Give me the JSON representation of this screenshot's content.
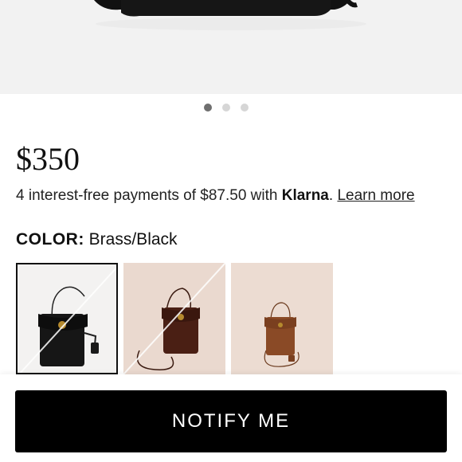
{
  "product": {
    "price": "$350",
    "installments_text": "4 interest-free payments of $87.50 with ",
    "klarna_label": "Klarna",
    "separator": ". ",
    "learn_more": "Learn more"
  },
  "gallery": {
    "image_count": 3,
    "active_index": 0
  },
  "color": {
    "label": "COLOR:",
    "value": "Brass/Black",
    "swatches": [
      {
        "name": "Brass/Black",
        "bag_color": "#161616",
        "bg_color": "#f3f2f1",
        "selected": true,
        "unavailable": true
      },
      {
        "name": "Brown",
        "bag_color": "#4a1f14",
        "bg_color": "#ead9cf",
        "selected": false,
        "unavailable": true
      },
      {
        "name": "Tan",
        "bag_color": "#8a4a26",
        "bg_color": "#ecdcd2",
        "selected": false,
        "unavailable": false
      }
    ]
  },
  "cta": {
    "label": "NOTIFY ME"
  },
  "colors": {
    "button_bg": "#000000",
    "button_text": "#ffffff",
    "hero_bg": "#f2f2f2"
  }
}
